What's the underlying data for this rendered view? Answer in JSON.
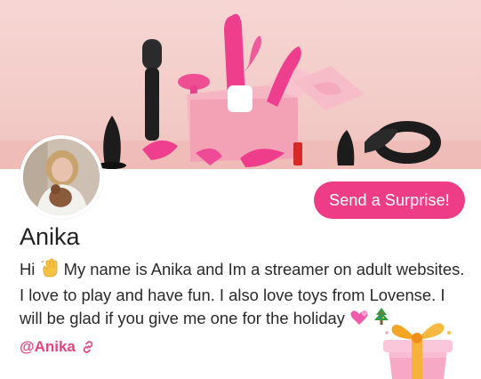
{
  "profile": {
    "name": "Anika",
    "cta_label": "Send a Surprise!",
    "bio_lines": [
      "Hi",
      "My name is Anika and Im a streamer on adult websites.",
      "I love to play and have fun. I also love toys from Lovense. I",
      "will be glad if you give me one for the holiday"
    ],
    "handle": "@Anika"
  },
  "icons": {
    "wave": "waving-hand-icon",
    "hearts": "two-hearts-icon",
    "tree": "christmas-tree-icon",
    "link": "link-icon",
    "gift": "gift-box-icon"
  },
  "colors": {
    "accent": "#ee3d86",
    "handle": "#e8447f",
    "banner": "#f3cdc9"
  }
}
